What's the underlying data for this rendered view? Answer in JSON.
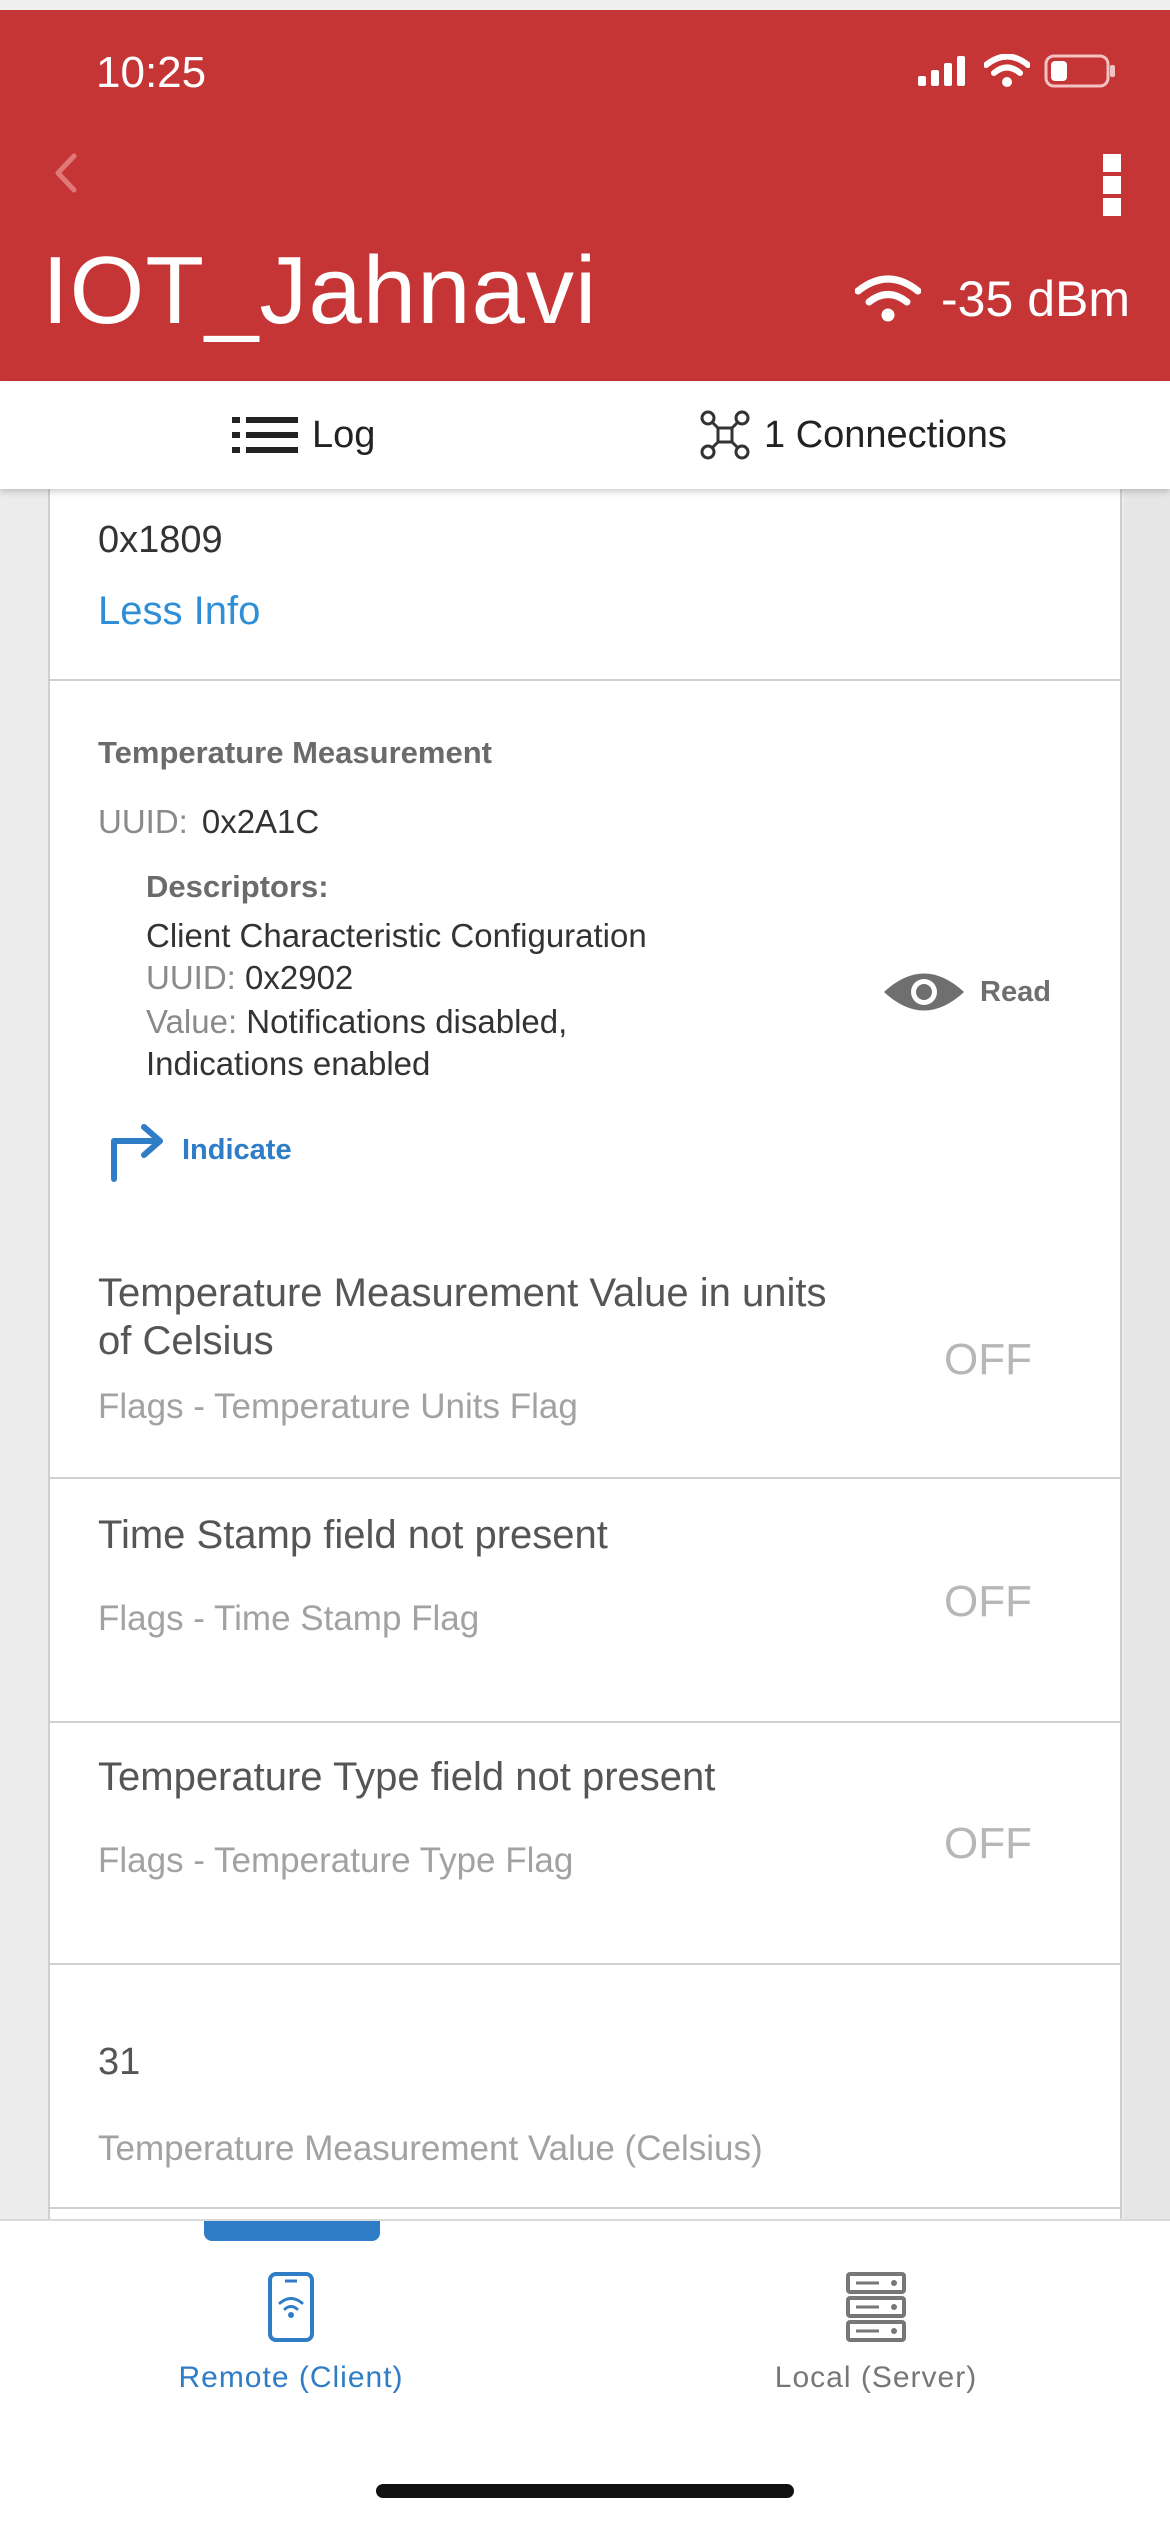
{
  "status_bar": {
    "time": "10:25"
  },
  "header": {
    "title": "IOT_Jahnavi",
    "rssi": "-35 dBm",
    "color": "#c63535"
  },
  "tabs": {
    "log": "Log",
    "connections": "1 Connections"
  },
  "service": {
    "uuid": "0x1809",
    "less_info": "Less Info"
  },
  "characteristic": {
    "name": "Temperature Measurement",
    "uuid_label": "UUID:",
    "uuid": "0x2A1C",
    "descriptors_label": "Descriptors:",
    "descriptor_name": "Client Characteristic Configuration",
    "descriptor_uuid_label": "UUID:",
    "descriptor_uuid": "0x2902",
    "descriptor_value_label": "Value:",
    "descriptor_value": "Notifications disabled, Indications enabled",
    "read_label": "Read",
    "indicate_label": "Indicate"
  },
  "fields": [
    {
      "title": "Temperature Measurement Value in units of Celsius",
      "subtitle": "Flags - Temperature Units Flag",
      "state": "OFF"
    },
    {
      "title": "Time Stamp field not present",
      "subtitle": "Flags - Time Stamp Flag",
      "state": "OFF"
    },
    {
      "title": "Temperature Type field not present",
      "subtitle": "Flags - Temperature Type Flag",
      "state": "OFF"
    }
  ],
  "measurement": {
    "value": "31",
    "label": "Temperature Measurement Value (Celsius)"
  },
  "bottom_nav": {
    "client": "Remote (Client)",
    "server": "Local (Server)",
    "active_color": "#2f7cc7"
  }
}
